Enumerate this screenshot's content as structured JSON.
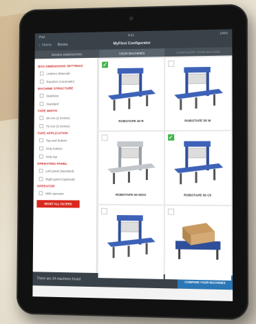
{
  "status": {
    "left": "iPad",
    "center": "9:41",
    "right": "100%"
  },
  "navbar": {
    "back_label": "Home",
    "section_label": "Boxes",
    "title": "MyFlexi Configurator"
  },
  "tabs": [
    {
      "label": "Boxes dimensions"
    },
    {
      "label": "Your machines"
    },
    {
      "label": "Configure your machine"
    }
  ],
  "filters": {
    "sections": [
      {
        "title": "BOX DIMENSIONS SETTINGS",
        "options": [
          "Uniform (Manual)",
          "Random (Automatic)"
        ]
      },
      {
        "title": "MACHINE STRUCTURE",
        "options": [
          "Stainless",
          "Standard"
        ]
      },
      {
        "title": "TAPE WIDTH",
        "options": [
          "48 mm (2 inches)",
          "75 mm (3 inches)"
        ]
      },
      {
        "title": "TAPE APPLICATION",
        "options": [
          "Top and bottom",
          "Only bottom",
          "Only top"
        ]
      },
      {
        "title": "OPERATING PANEL",
        "options": [
          "Left panel (standard)",
          "Right panel (optional)"
        ]
      },
      {
        "title": "OPERATOR",
        "options": [
          "With operator"
        ]
      }
    ],
    "reset_label": "Reset all filters"
  },
  "machines": [
    {
      "name": "ROBOTAPE 40 R",
      "selected": true,
      "finish": "blue"
    },
    {
      "name": "ROBOTAPE 50 W",
      "selected": false,
      "finish": "blue"
    },
    {
      "name": "ROBOTAPE 50 INOX",
      "selected": false,
      "finish": "steel"
    },
    {
      "name": "ROBOTAPE 50 CF",
      "selected": true,
      "finish": "blue"
    },
    {
      "name": "",
      "selected": false,
      "finish": "blue"
    },
    {
      "name": "",
      "selected": false,
      "finish": "box"
    }
  ],
  "footer": {
    "count_text": "There are 24 machines found",
    "compare_label": "Compare your machines"
  },
  "colors": {
    "accent_red": "#d9281f",
    "check_green": "#3fb24a",
    "compare_blue": "#2c77b5",
    "machine_blue": "#2f4f9a"
  }
}
